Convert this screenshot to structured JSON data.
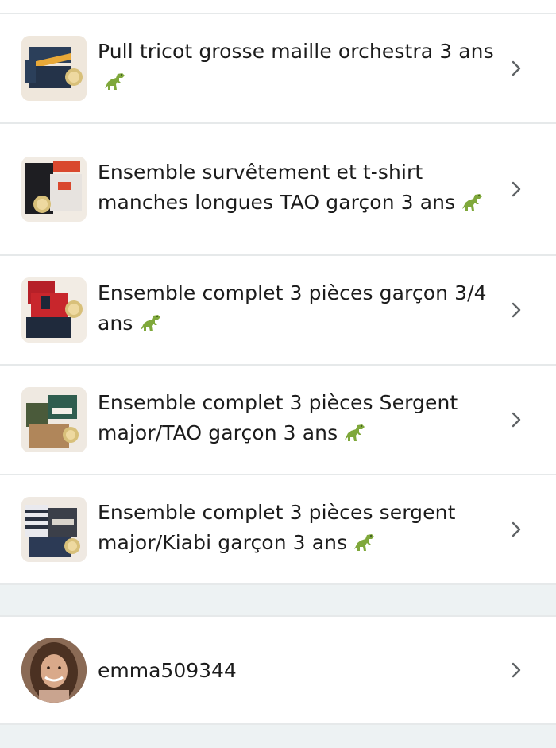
{
  "items": [
    {
      "title": "Pull tricot grosse maille orchestra 3 ans",
      "icon": "dinosaur-icon"
    },
    {
      "title": "Ensemble survêtement et t-shirt manches longues TAO garçon 3 ans",
      "icon": "dinosaur-icon"
    },
    {
      "title": "Ensemble complet 3 pièces garçon 3/4 ans",
      "icon": "dinosaur-icon"
    },
    {
      "title": "Ensemble complet 3 pièces Sergent major/TAO garçon 3 ans",
      "icon": "dinosaur-icon"
    },
    {
      "title": "Ensemble complet 3 pièces sergent major/Kiabi garçon 3 ans",
      "icon": "dinosaur-icon"
    }
  ],
  "user": {
    "username": "emma509344"
  },
  "colors": {
    "divider": "#e6e9ea",
    "section_bg": "#edf2f3",
    "text": "#1c1c1c",
    "chevron": "#5f6366"
  }
}
